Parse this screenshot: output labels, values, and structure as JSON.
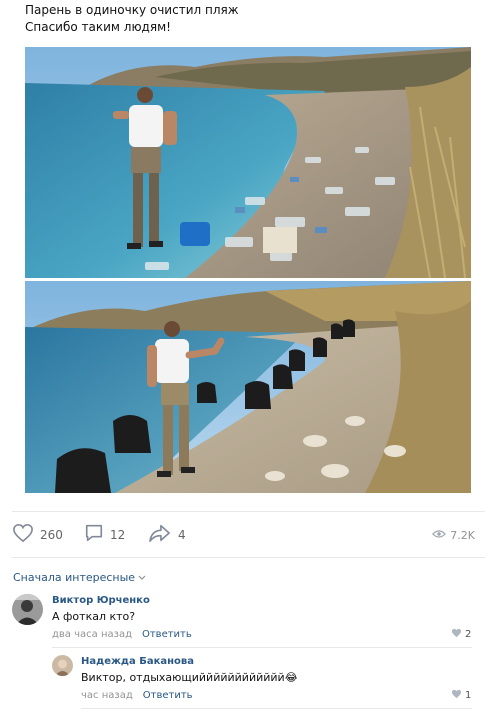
{
  "post": {
    "line1": "Парень в одиночку очистил пляж",
    "line2": "Спасибо таким людям!"
  },
  "actions": {
    "likes": "260",
    "comments": "12",
    "shares": "4",
    "views": "7.2K"
  },
  "comments_section": {
    "sort_label": "Сначала интересные"
  },
  "comments": [
    {
      "author": "Виктор Юрченко",
      "text": "А фоткал кто?",
      "time": "два часа назад",
      "reply_label": "Ответить",
      "likes": "2"
    },
    {
      "author": "Надежда Баканова",
      "text": "Виктор, отдыхающийййййййййййй😂",
      "time": "час назад",
      "reply_label": "Ответить",
      "likes": "1"
    }
  ],
  "icons": [
    "heart-icon",
    "comment-icon",
    "share-icon",
    "eye-icon",
    "chevron-down-icon"
  ]
}
